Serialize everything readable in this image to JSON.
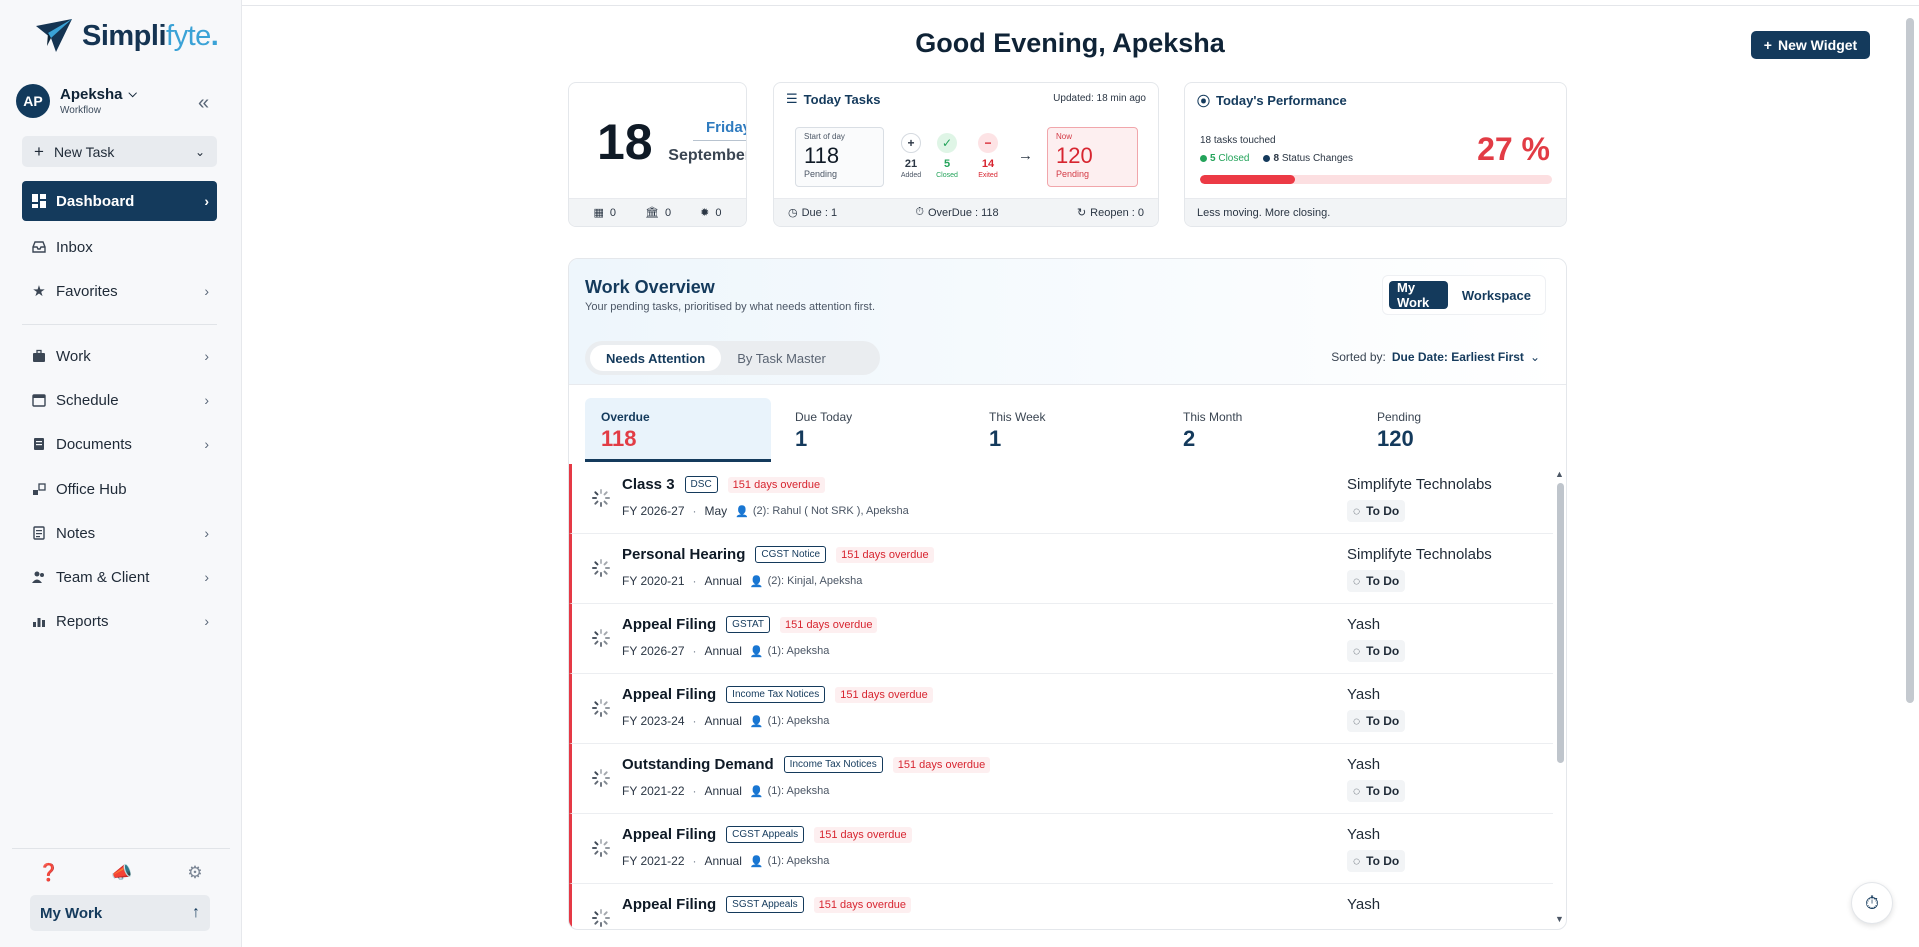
{
  "brand": {
    "name_main": "Simpli",
    "name_light": "fyte",
    "name_dot": ".",
    "colors": {
      "primary": "#143a5c",
      "accent": "#3aa2d6",
      "danger": "#e23c45"
    }
  },
  "profile": {
    "initials": "AP",
    "name": "Apeksha",
    "role": "Workflow"
  },
  "sidebar": {
    "new_task_label": "New Task",
    "items": [
      {
        "label": "Dashboard",
        "icon": "dashboard-icon"
      },
      {
        "label": "Inbox",
        "icon": "inbox-icon"
      },
      {
        "label": "Favorites",
        "icon": "star-icon"
      },
      {
        "label": "Work",
        "icon": "briefcase-icon"
      },
      {
        "label": "Schedule",
        "icon": "calendar-icon"
      },
      {
        "label": "Documents",
        "icon": "document-icon"
      },
      {
        "label": "Office Hub",
        "icon": "office-icon"
      },
      {
        "label": "Notes",
        "icon": "notes-icon"
      },
      {
        "label": "Team & Client",
        "icon": "team-icon"
      },
      {
        "label": "Reports",
        "icon": "reports-icon"
      }
    ],
    "bottom_button": "My Work"
  },
  "header": {
    "greeting": "Good Evening, Apeksha",
    "new_widget_label": "New Widget"
  },
  "date_card": {
    "day_num": "18",
    "weekday": "Friday",
    "month": "September",
    "foot": [
      "0",
      "0",
      "0"
    ]
  },
  "tasks_card": {
    "title": "Today Tasks",
    "updated": "Updated: 18 min ago",
    "start_label": "Start of day",
    "start_value": "118",
    "start_sub": "Pending",
    "added": "21",
    "added_label": "Added",
    "closed": "5",
    "closed_label": "Closed",
    "exited": "14",
    "exited_label": "Exited",
    "now_label": "Now",
    "now_value": "120",
    "now_sub": "Pending",
    "due": "Due : 1",
    "overdue": "OverDue : 118",
    "reopen": "Reopen : 0"
  },
  "perf_card": {
    "title": "Today's Performance",
    "touched": "18 tasks touched",
    "closed_num": "5",
    "closed_text": "Closed",
    "status_num": "8",
    "status_text": "Status Changes",
    "percent": "27 %",
    "progress_fraction": 0.27,
    "footer": "Less moving. More closing."
  },
  "work_overview": {
    "title": "Work Overview",
    "subtitle": "Your pending tasks, prioritised by what needs attention first.",
    "toggle": [
      "My Work",
      "Workspace"
    ],
    "segments": [
      "Needs Attention",
      "By Task Master"
    ],
    "sorted_label": "Sorted by:",
    "sorted_value": "Due Date: Earliest First",
    "categories": [
      {
        "label": "Overdue",
        "value": "118"
      },
      {
        "label": "Due Today",
        "value": "1"
      },
      {
        "label": "This Week",
        "value": "1"
      },
      {
        "label": "This Month",
        "value": "2"
      },
      {
        "label": "Pending",
        "value": "120"
      }
    ],
    "rows": [
      {
        "title": "Class 3",
        "tag": "DSC",
        "overdue": "151 days overdue",
        "fy": "FY 2026-27",
        "period": "May",
        "assignees": "(2): Rahul ( Not SRK ), Apeksha",
        "client": "Simplifyte Technolabs",
        "status": "To Do"
      },
      {
        "title": "Personal Hearing",
        "tag": "CGST Notice",
        "overdue": "151 days overdue",
        "fy": "FY 2020-21",
        "period": "Annual",
        "assignees": "(2): Kinjal, Apeksha",
        "client": "Simplifyte Technolabs",
        "status": "To Do"
      },
      {
        "title": "Appeal Filing",
        "tag": "GSTAT",
        "overdue": "151 days overdue",
        "fy": "FY 2026-27",
        "period": "Annual",
        "assignees": "(1): Apeksha",
        "client": "Yash",
        "status": "To Do"
      },
      {
        "title": "Appeal Filing",
        "tag": "Income Tax Notices",
        "overdue": "151 days overdue",
        "fy": "FY 2023-24",
        "period": "Annual",
        "assignees": "(1): Apeksha",
        "client": "Yash",
        "status": "To Do"
      },
      {
        "title": "Outstanding Demand",
        "tag": "Income Tax Notices",
        "overdue": "151 days overdue",
        "fy": "FY 2021-22",
        "period": "Annual",
        "assignees": "(1): Apeksha",
        "client": "Yash",
        "status": "To Do"
      },
      {
        "title": "Appeal Filing",
        "tag": "CGST Appeals",
        "overdue": "151 days overdue",
        "fy": "FY 2021-22",
        "period": "Annual",
        "assignees": "(1): Apeksha",
        "client": "Yash",
        "status": "To Do"
      },
      {
        "title": "Appeal Filing",
        "tag": "SGST Appeals",
        "overdue": "151 days overdue",
        "fy": "",
        "period": "",
        "assignees": "",
        "client": "Yash",
        "status": ""
      }
    ]
  }
}
